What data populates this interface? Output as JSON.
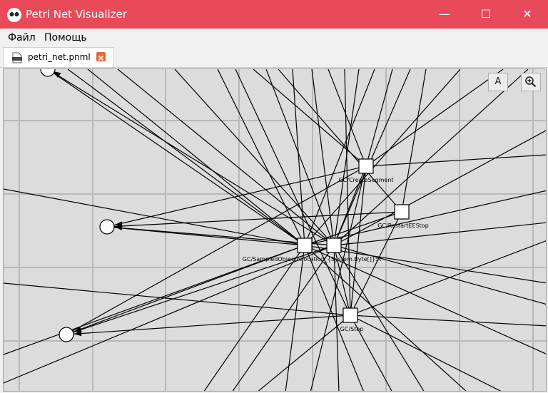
{
  "window": {
    "title": "Petri Net Visualizer",
    "minimize_glyph": "—",
    "maximize_glyph": "☐",
    "close_glyph": "✕",
    "accent": "#e84a5a"
  },
  "menu": {
    "items": [
      "Файл",
      "Помощь"
    ]
  },
  "tabs": [
    {
      "label": "petri_net.pnml",
      "icon": "pnml-file-icon",
      "close_color": "#e8643c"
    }
  ],
  "canvas": {
    "toolbar": {
      "font_button_label": "A",
      "zoom_icon": "zoom-in-icon"
    },
    "transitions": [
      {
        "label": "GC/CreateSegment"
      },
      {
        "label": "GC/RestartEEStop"
      },
      {
        "label": "GC/SampledObjectAllocation_{System.Byte[]}:R"
      },
      {
        "label": "GC/Stop"
      }
    ],
    "places_count": 3
  }
}
